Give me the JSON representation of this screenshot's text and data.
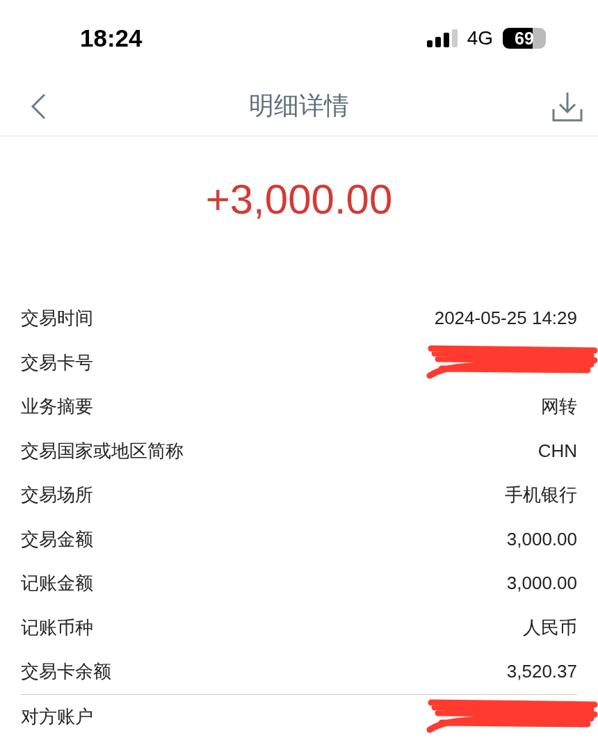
{
  "status_bar": {
    "time": "18:24",
    "network": "4G",
    "battery": "69"
  },
  "nav": {
    "title": "明细详情"
  },
  "amount": "+3,000.00",
  "rows": [
    {
      "label": "交易时间",
      "kind": "text",
      "value": "2024-05-25 14:29"
    },
    {
      "label": "交易卡号",
      "kind": "redacted"
    },
    {
      "label": "业务摘要",
      "kind": "text",
      "value": "网转"
    },
    {
      "label": "交易国家或地区简称",
      "kind": "text",
      "value": "CHN"
    },
    {
      "label": "交易场所",
      "kind": "text",
      "value": "手机银行"
    },
    {
      "label": "交易金额",
      "kind": "text",
      "value": "3,000.00"
    },
    {
      "label": "记账金额",
      "kind": "text",
      "value": "3,000.00"
    },
    {
      "label": "记账币种",
      "kind": "text",
      "value": "人民币"
    },
    {
      "label": "交易卡余额",
      "kind": "text",
      "value": "3,520.37"
    },
    {
      "label": "对方账户",
      "kind": "redacted"
    }
  ]
}
